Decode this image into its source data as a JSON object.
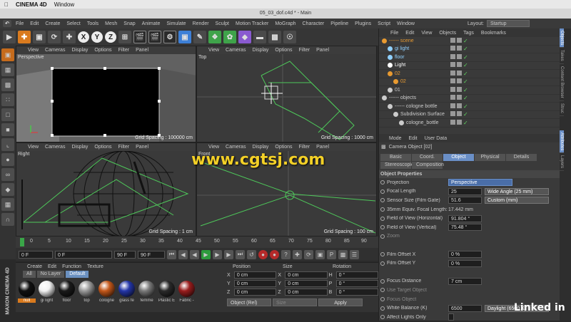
{
  "mac": {
    "app": "CINEMA 4D",
    "window_menu": "Window"
  },
  "window": {
    "title": "05_03_dof.c4d * - Main"
  },
  "menus": [
    "File",
    "Edit",
    "Create",
    "Select",
    "Tools",
    "Mesh",
    "Snap",
    "Animate",
    "Simulate",
    "Render",
    "Sculpt",
    "Motion Tracker",
    "MoGraph",
    "Character",
    "Pipeline",
    "Plugins",
    "Script",
    "Window"
  ],
  "layout": {
    "label": "Layout:",
    "value": "Startup"
  },
  "toolbar": {
    "x": "X",
    "y": "Y",
    "z": "Z"
  },
  "viewport_menu": [
    "View",
    "Cameras",
    "Display",
    "Options",
    "Filter",
    "Panel"
  ],
  "viewports": [
    {
      "label": "Perspective",
      "info": "Grid Spacing : 100000 cm"
    },
    {
      "label": "Top",
      "info": "Grid Spacing : 1000 cm"
    },
    {
      "label": "Right",
      "info": "Grid Spacing : 1 cm"
    },
    {
      "label": "Front",
      "info": "Grid Spacing : 100 cm"
    }
  ],
  "timeline": {
    "ticks": [
      "0",
      "5",
      "10",
      "15",
      "20",
      "25",
      "30",
      "35",
      "40",
      "45",
      "50",
      "55",
      "60",
      "65",
      "70",
      "75",
      "80",
      "85",
      "90"
    ],
    "end": "0 F"
  },
  "transport": {
    "start": "0 F",
    "current": "0 F",
    "end1": "90 F",
    "end2": "90 F"
  },
  "material_manager": {
    "menu": [
      "Create",
      "Edit",
      "Function",
      "Texture"
    ],
    "tabs": [
      "All",
      "No Layer",
      "Default"
    ],
    "materials": [
      {
        "name": "null",
        "color": "#111111"
      },
      {
        "name": "gi light",
        "color": "#f2f2f2"
      },
      {
        "name": "floor",
        "color": "#1a1a1a"
      },
      {
        "name": "top",
        "color": "#9a9a9a"
      },
      {
        "name": "cologne",
        "color": "#c4581a"
      },
      {
        "name": "glass fe",
        "color": "#2436a8"
      },
      {
        "name": "femme",
        "color": "#7a7a7a"
      },
      {
        "name": "Plastic E",
        "color": "#2a2a2a"
      },
      {
        "name": "Fabric -",
        "color": "#9a1d1d"
      }
    ]
  },
  "coords": {
    "headers": [
      "Position",
      "Size",
      "Rotation"
    ],
    "rows": [
      {
        "axis": "X",
        "pos": "0 cm",
        "size": "0 cm",
        "rax": "H",
        "rot": "0 °"
      },
      {
        "axis": "Y",
        "pos": "0 cm",
        "size": "0 cm",
        "rax": "P",
        "rot": "0 °"
      },
      {
        "axis": "Z",
        "pos": "0 cm",
        "size": "0 cm",
        "rax": "B",
        "rot": "0 °"
      }
    ],
    "mode": "Object (Rel)",
    "size_mode": "Size",
    "apply": "Apply"
  },
  "object_manager": {
    "menu": [
      "File",
      "Edit",
      "View",
      "Objects",
      "Tags",
      "Bookmarks"
    ],
    "objects": [
      {
        "name": "------ scene",
        "indent": 0,
        "color": "#e89a30"
      },
      {
        "name": "gi light",
        "indent": 1,
        "color": "#8fd0ff"
      },
      {
        "name": "floor",
        "indent": 1,
        "color": "#8fd0ff"
      },
      {
        "name": "Light",
        "indent": 1,
        "color": "#ffffff"
      },
      {
        "name": "02",
        "indent": 1,
        "color": "#e89a30"
      },
      {
        "name": "02",
        "indent": 2,
        "color": "#e89a30"
      },
      {
        "name": "01",
        "indent": 1,
        "color": "#cccccc"
      },
      {
        "name": "------ objects",
        "indent": 0,
        "color": "#cccccc"
      },
      {
        "name": "------ cologne bottle",
        "indent": 1,
        "color": "#cccccc"
      },
      {
        "name": "Subdivision Surface",
        "indent": 2,
        "color": "#cccccc"
      },
      {
        "name": "cologne_bottle",
        "indent": 3,
        "color": "#cccccc"
      }
    ]
  },
  "attribute_manager": {
    "menu": [
      "Mode",
      "Edit",
      "User Data"
    ],
    "object_title": "Camera Object [02]",
    "tabs": [
      "Basic",
      "Coord.",
      "Object",
      "Physical",
      "Details",
      "Stereoscopic",
      "Composition"
    ],
    "section": "Object Properties",
    "props": [
      {
        "label": "Projection",
        "value": "Perspective",
        "kind": "dropdown"
      },
      {
        "label": "Focal Length",
        "value": "25",
        "extra": "Wide Angle (25 mm)",
        "kind": "field"
      },
      {
        "label": "Sensor Size (Film Gate)",
        "value": "51.6",
        "extra": "Custom (mm)",
        "kind": "field"
      },
      {
        "label": "35mm Equiv. Focal Length:",
        "value": "17.442 mm",
        "kind": "text"
      },
      {
        "label": "Field of View (Horizontal)",
        "value": "91.804 °",
        "kind": "field"
      },
      {
        "label": "Field of View (Vertical)",
        "value": "75.48 °",
        "kind": "field"
      },
      {
        "label": "Zoom",
        "value": "",
        "kind": "dim"
      },
      {
        "label": "",
        "value": "",
        "kind": "blank"
      },
      {
        "label": "Film Offset X",
        "value": "0 %",
        "kind": "field"
      },
      {
        "label": "Film Offset Y",
        "value": "0 %",
        "kind": "field"
      },
      {
        "label": "",
        "value": "",
        "kind": "blank"
      },
      {
        "label": "Focus Distance",
        "value": "7 cm",
        "kind": "field"
      },
      {
        "label": "Use Target Object",
        "value": "",
        "kind": "dim"
      },
      {
        "label": "Focus Object",
        "value": "",
        "kind": "dim"
      },
      {
        "label": "White Balance (K)",
        "value": "6500",
        "extra": "Daylight (6500 K)",
        "kind": "field"
      },
      {
        "label": "Affect Lights Only",
        "value": "",
        "kind": "check"
      }
    ]
  },
  "right_tabs": [
    "Objects",
    "Takes",
    "Content Browser",
    "Struc",
    "Attributes",
    "Layers"
  ],
  "maxon": "MAXON CINEMA 4D",
  "watermark": "www.cgtsj.com",
  "linkedin": "Linked in"
}
